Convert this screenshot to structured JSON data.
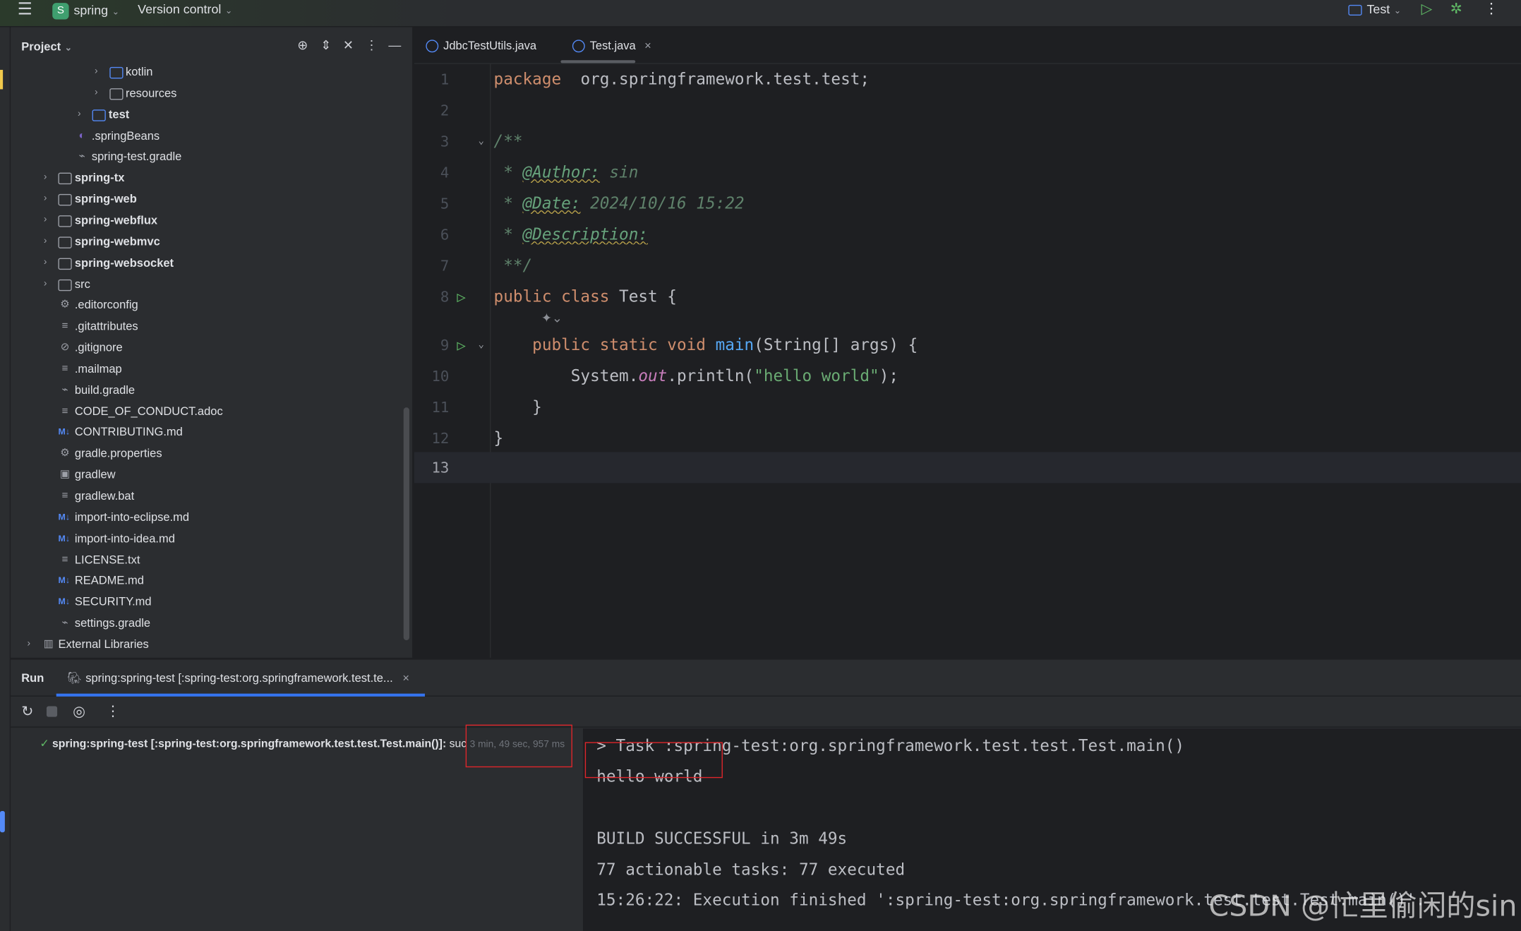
{
  "titlebar": {
    "project_initial": "S",
    "project": "spring",
    "vcs": "Version control",
    "run_config": "Test"
  },
  "project_panel": {
    "title": "Project",
    "items": [
      {
        "label": "kotlin",
        "level": 4,
        "type": "folder-blue",
        "arrow": true
      },
      {
        "label": "resources",
        "level": 4,
        "type": "folder-res",
        "arrow": true
      },
      {
        "label": "test",
        "level": 3,
        "type": "folder-blue",
        "arrow": true,
        "bold": true
      },
      {
        "label": ".springBeans",
        "level": 2,
        "type": "spring-file"
      },
      {
        "label": "spring-test.gradle",
        "level": 2,
        "type": "gradle"
      },
      {
        "label": "spring-tx",
        "level": 1,
        "type": "module",
        "arrow": true,
        "bold": true
      },
      {
        "label": "spring-web",
        "level": 1,
        "type": "module",
        "arrow": true,
        "bold": true
      },
      {
        "label": "spring-webflux",
        "level": 1,
        "type": "module",
        "arrow": true,
        "bold": true
      },
      {
        "label": "spring-webmvc",
        "level": 1,
        "type": "module",
        "arrow": true,
        "bold": true
      },
      {
        "label": "spring-websocket",
        "level": 1,
        "type": "module",
        "arrow": true,
        "bold": true
      },
      {
        "label": "src",
        "level": 1,
        "type": "folder",
        "arrow": true
      },
      {
        "label": ".editorconfig",
        "level": 1,
        "type": "settings"
      },
      {
        "label": ".gitattributes",
        "level": 1,
        "type": "text"
      },
      {
        "label": ".gitignore",
        "level": 1,
        "type": "ignore"
      },
      {
        "label": ".mailmap",
        "level": 1,
        "type": "text"
      },
      {
        "label": "build.gradle",
        "level": 1,
        "type": "gradle"
      },
      {
        "label": "CODE_OF_CONDUCT.adoc",
        "level": 1,
        "type": "text"
      },
      {
        "label": "CONTRIBUTING.md",
        "level": 1,
        "type": "markdown"
      },
      {
        "label": "gradle.properties",
        "level": 1,
        "type": "settings"
      },
      {
        "label": "gradlew",
        "level": 1,
        "type": "shell"
      },
      {
        "label": "gradlew.bat",
        "level": 1,
        "type": "text"
      },
      {
        "label": "import-into-eclipse.md",
        "level": 1,
        "type": "markdown"
      },
      {
        "label": "import-into-idea.md",
        "level": 1,
        "type": "markdown"
      },
      {
        "label": "LICENSE.txt",
        "level": 1,
        "type": "text"
      },
      {
        "label": "README.md",
        "level": 1,
        "type": "markdown"
      },
      {
        "label": "SECURITY.md",
        "level": 1,
        "type": "markdown"
      },
      {
        "label": "settings.gradle",
        "level": 1,
        "type": "gradle"
      },
      {
        "label": "External Libraries",
        "level": 0,
        "type": "library",
        "arrow": true
      }
    ]
  },
  "editor": {
    "tabs": [
      {
        "label": "JdbcTestUtils.java"
      },
      {
        "label": "Test.java",
        "active": true
      }
    ],
    "lines": [
      {
        "n": "1",
        "html": [
          [
            "kw",
            "package"
          ],
          [
            "",
            "  org.springframework.test.test;"
          ]
        ]
      },
      {
        "n": "2",
        "html": []
      },
      {
        "n": "3",
        "html": [
          [
            "doc",
            "/**"
          ]
        ],
        "fold": true
      },
      {
        "n": "4",
        "html": [
          [
            "doc",
            " * "
          ],
          [
            "tag",
            "@Author:"
          ],
          [
            "doc",
            " sin"
          ]
        ]
      },
      {
        "n": "5",
        "html": [
          [
            "doc",
            " * "
          ],
          [
            "tag",
            "@Date:"
          ],
          [
            "doc",
            " 2024/10/16 15:22"
          ]
        ]
      },
      {
        "n": "6",
        "html": [
          [
            "doc",
            " * "
          ],
          [
            "tag",
            "@Description:"
          ]
        ]
      },
      {
        "n": "7",
        "html": [
          [
            "doc",
            " **/"
          ]
        ]
      },
      {
        "n": "8",
        "html": [
          [
            "kw",
            "public class "
          ],
          [
            "",
            "Test {"
          ]
        ],
        "run": true
      },
      {
        "n": "9",
        "html": [
          [
            "kw",
            "    public static void "
          ],
          [
            "fn",
            "main"
          ],
          [
            "",
            "(String[] args) {"
          ]
        ],
        "run": true,
        "fold": true
      },
      {
        "n": "10",
        "html": [
          [
            "",
            "        System."
          ],
          [
            "fld",
            "out"
          ],
          [
            "",
            ".println("
          ],
          [
            "str",
            "\"hello world\""
          ],
          [
            "",
            ");"
          ]
        ]
      },
      {
        "n": "11",
        "html": [
          [
            "",
            "    }"
          ]
        ]
      },
      {
        "n": "12",
        "html": [
          [
            "",
            "}"
          ]
        ]
      },
      {
        "n": "13",
        "html": [],
        "current": true
      }
    ]
  },
  "run": {
    "title": "Run",
    "tab": "spring:spring-test [:spring-test:org.springframework.test.te...",
    "task": "spring:spring-test [:spring-test:org.springframework.test.test.Test.main()]:",
    "status": "suc",
    "duration": "3 min, 49 sec, 957 ms",
    "console": [
      "> Task :spring-test:org.springframework.test.test.Test.main()",
      "hello world",
      "",
      "BUILD SUCCESSFUL in 3m 49s",
      "77 actionable tasks: 77 executed",
      "15:26:22: Execution finished ':spring-test:org.springframework.test.test.Test.main()'."
    ]
  },
  "watermark": "CSDN @忙里偷闲的sin",
  "colors": {
    "accent": "#548af7",
    "run_green": "#5fb865",
    "highlight_box": "#e0262b"
  }
}
